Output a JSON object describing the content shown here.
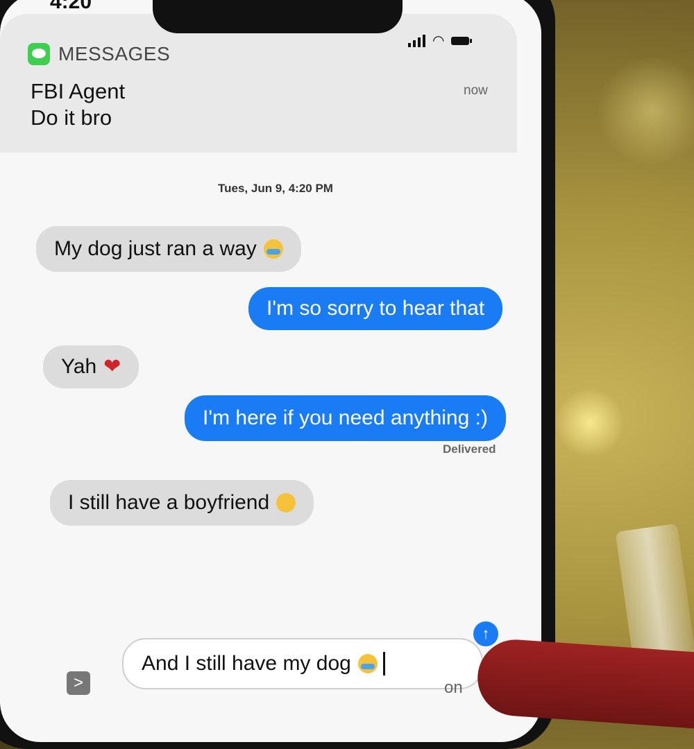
{
  "status_bar": {
    "time": "4:20"
  },
  "notification": {
    "app_name": "MESSAGES",
    "sender": "FBI Agent",
    "body": "Do it bro",
    "time": "now"
  },
  "conversation": {
    "timestamp": "Tues, Jun 9, 4:20 PM",
    "messages": [
      {
        "direction": "in",
        "text": "My dog just ran a way",
        "emoji": "crying-laughing-emoji"
      },
      {
        "direction": "out",
        "text": "I'm so sorry to hear that"
      },
      {
        "direction": "in",
        "text": "Yah",
        "emoji": "broken-heart-emoji"
      },
      {
        "direction": "out",
        "text": "I'm here if you need anything :)"
      },
      {
        "direction": "in",
        "text": "I still have a boyfriend",
        "emoji": "flushed-emoji"
      }
    ],
    "delivered_label": "Delivered"
  },
  "composer": {
    "text": "And I still have my dog",
    "emoji": "crying-laughing-emoji",
    "expand_glyph": ">",
    "send_glyph": "↑",
    "keyboard_hint": "on"
  },
  "colors": {
    "incoming_bubble": "#dcdcdc",
    "outgoing_bubble": "#1a7cf5",
    "messages_icon": "#3ecf4f"
  }
}
